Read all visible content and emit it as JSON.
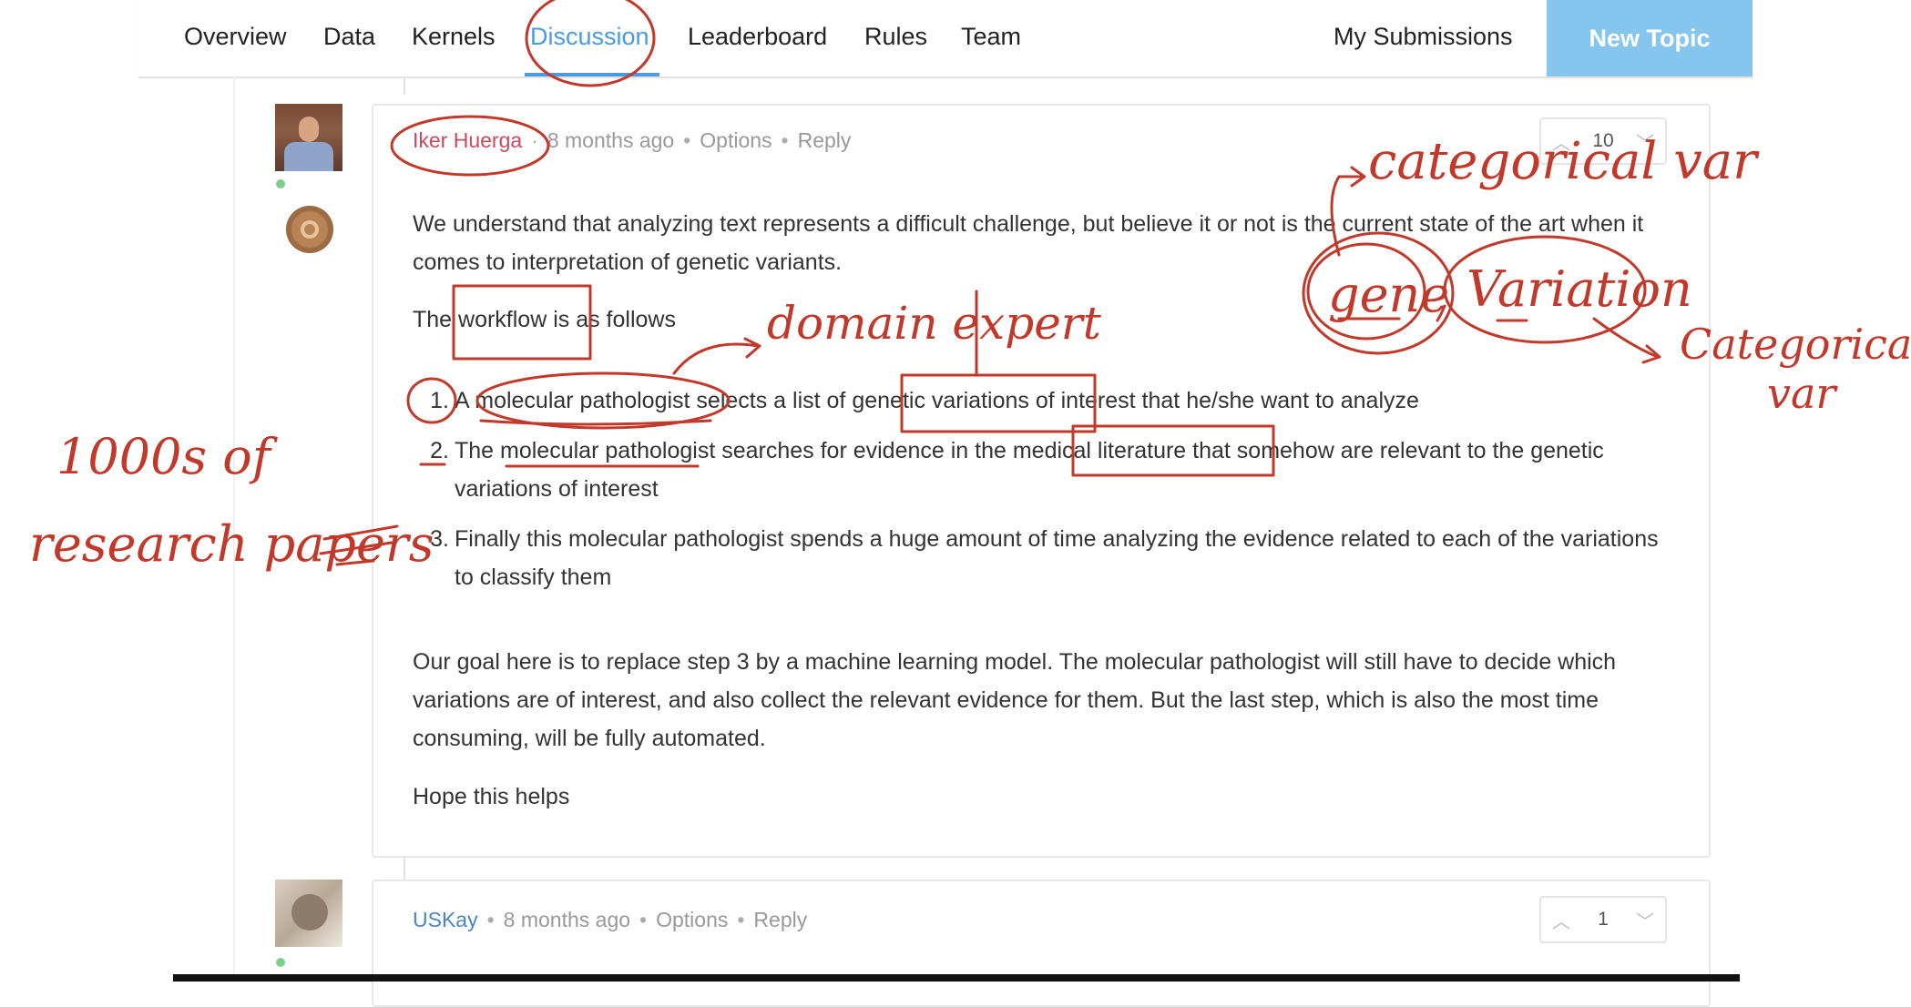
{
  "nav": {
    "tabs": [
      {
        "label": "Overview"
      },
      {
        "label": "Data"
      },
      {
        "label": "Kernels"
      },
      {
        "label": "Discussion"
      },
      {
        "label": "Leaderboard"
      },
      {
        "label": "Rules"
      },
      {
        "label": "Team"
      }
    ],
    "active_tab": "Discussion",
    "my_submissions": "My Submissions",
    "new_topic": "New Topic"
  },
  "comments": [
    {
      "author": "Iker Huerga",
      "time": "8 months ago",
      "options": "Options",
      "reply": "Reply",
      "votes": "10",
      "paragraphs": [
        "We understand that analyzing text represents a difficult challenge, but believe it or not is the current state of the art when it comes to interpretation of genetic variants.",
        "The workflow is as follows"
      ],
      "list": [
        {
          "num": "1.",
          "text": "A molecular pathologist selects a list of genetic variations of interest that he/she want to analyze"
        },
        {
          "num": "2.",
          "text": "The molecular pathologist searches for evidence in the medical literature that somehow are relevant to the genetic variations of interest"
        },
        {
          "num": "3.",
          "text": "Finally this molecular pathologist spends a huge amount of time analyzing the evidence related to each of the variations to classify them"
        }
      ],
      "closing": [
        "Our goal here is to replace step 3 by a machine learning model. The molecular pathologist will still have to decide which variations are of interest, and also collect the relevant evidence for them. But the last step, which is also the most time consuming, will be fully automated.",
        "Hope this helps"
      ]
    },
    {
      "author": "USKay",
      "time": "8 months ago",
      "options": "Options",
      "reply": "Reply",
      "votes": "1"
    }
  ],
  "annotations": {
    "categorical_var_top": "categorical var",
    "gene": "gene",
    "variation": "Variation",
    "categorical_var_right_1": "Categorical",
    "categorical_var_right_2": "var",
    "domain_expert": "domain expert",
    "research_papers_1": "1000s of",
    "research_papers_2": "research papers",
    "ink_color": "#c0392b"
  },
  "icons": {
    "upvote": "chevron-up-icon",
    "downvote": "chevron-down-icon",
    "badge": "medal-icon"
  }
}
